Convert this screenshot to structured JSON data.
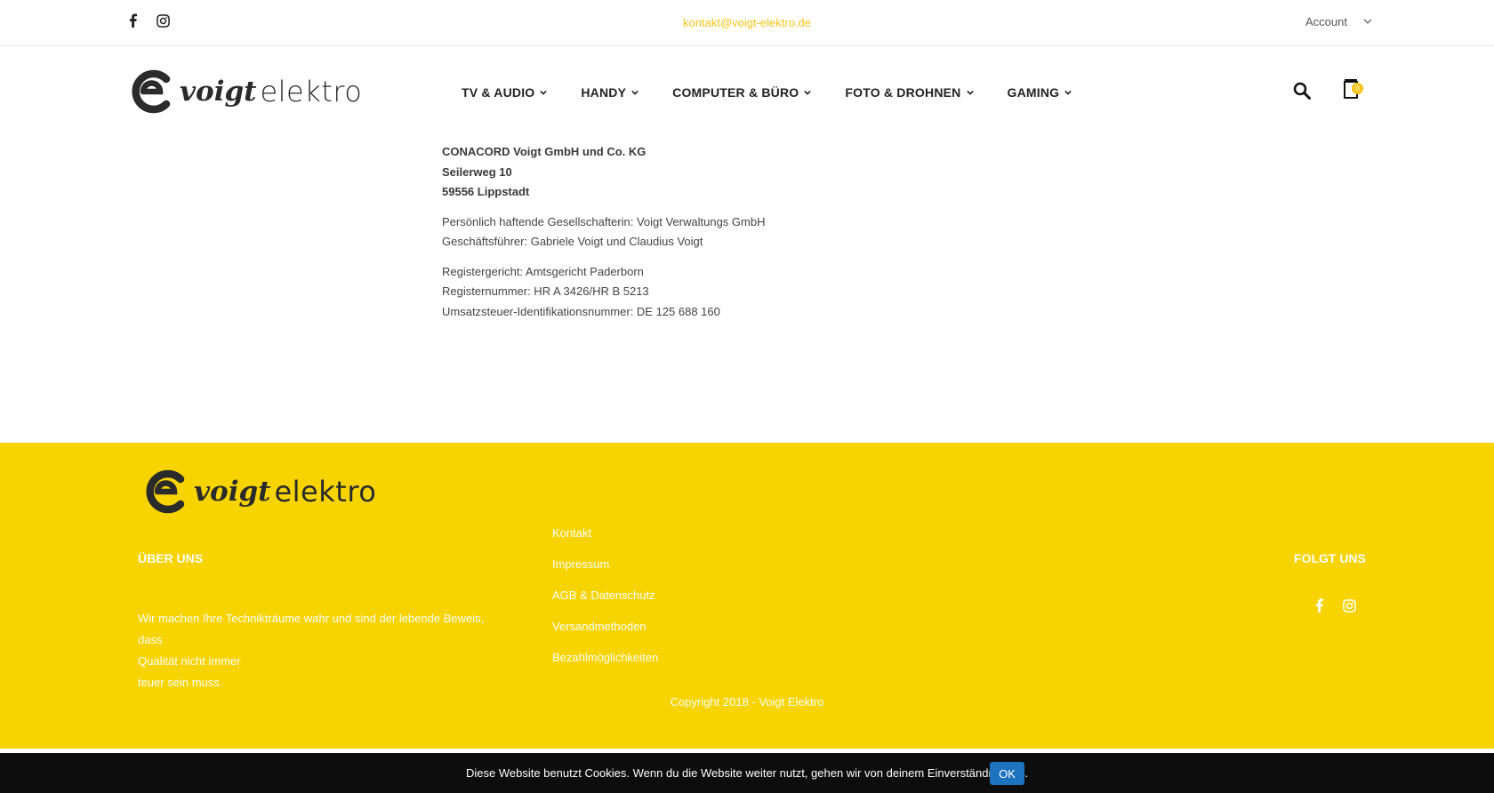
{
  "topbar": {
    "social_icons": [
      "facebook-icon",
      "instagram-icon"
    ],
    "email": "kontakt@voigt-elektro.de",
    "account_label": "Account"
  },
  "header": {
    "logo": {
      "word1": "voigt",
      "word2": "elektro"
    },
    "nav": [
      {
        "label": "TV & AUDIO"
      },
      {
        "label": "HANDY"
      },
      {
        "label": "COMPUTER & BÜRO"
      },
      {
        "label": "FOTO & DROHNEN"
      },
      {
        "label": "GAMING"
      }
    ],
    "cart_count": "0",
    "icons": [
      "search-icon",
      "cart-icon"
    ]
  },
  "content": {
    "company": "CONACORD Voigt GmbH und Co. KG",
    "street": "Seilerweg 10",
    "city": "59556 Lippstadt",
    "partner": "Persönlich haftende Gesellschafterin: Voigt Verwaltungs GmbH",
    "managers": "Geschäftsführer: Gabriele Voigt und Claudius Voigt",
    "court": "Registergericht: Amtsgericht Paderborn",
    "register_no": "Registernummer: HR A 3426/HR B 5213",
    "vat_id": "Umsatzsteuer-Identifikationsnummer: DE 125 688 160"
  },
  "footer": {
    "logo": {
      "word1": "voigt",
      "word2": "elektro"
    },
    "about_title": "ÜBER UNS",
    "about_line1": "Wir machen Ihre Technikträume wahr und sind der lebende Beweis, dass",
    "about_line2": "Qualität nicht immer",
    "about_line3": "teuer sein muss.",
    "links": [
      "Kontakt",
      "Impressum",
      "AGB & Datenschutz",
      "Versandmethoden",
      "Bezahlmöglichkeiten"
    ],
    "follow_title": "FOLGT UNS",
    "copyright": "Copyright 2018 - Voigt Elektro"
  },
  "cookie": {
    "text": "Diese Website benutzt Cookies. Wenn du die Website weiter nutzt, gehen wir von deinem Einverständnis aus.",
    "button": "OK"
  },
  "colors": {
    "accent": "#f7d300",
    "email": "#f5c518",
    "cookie_bar": "#0d0d0d",
    "ok_button": "#1e73be"
  }
}
